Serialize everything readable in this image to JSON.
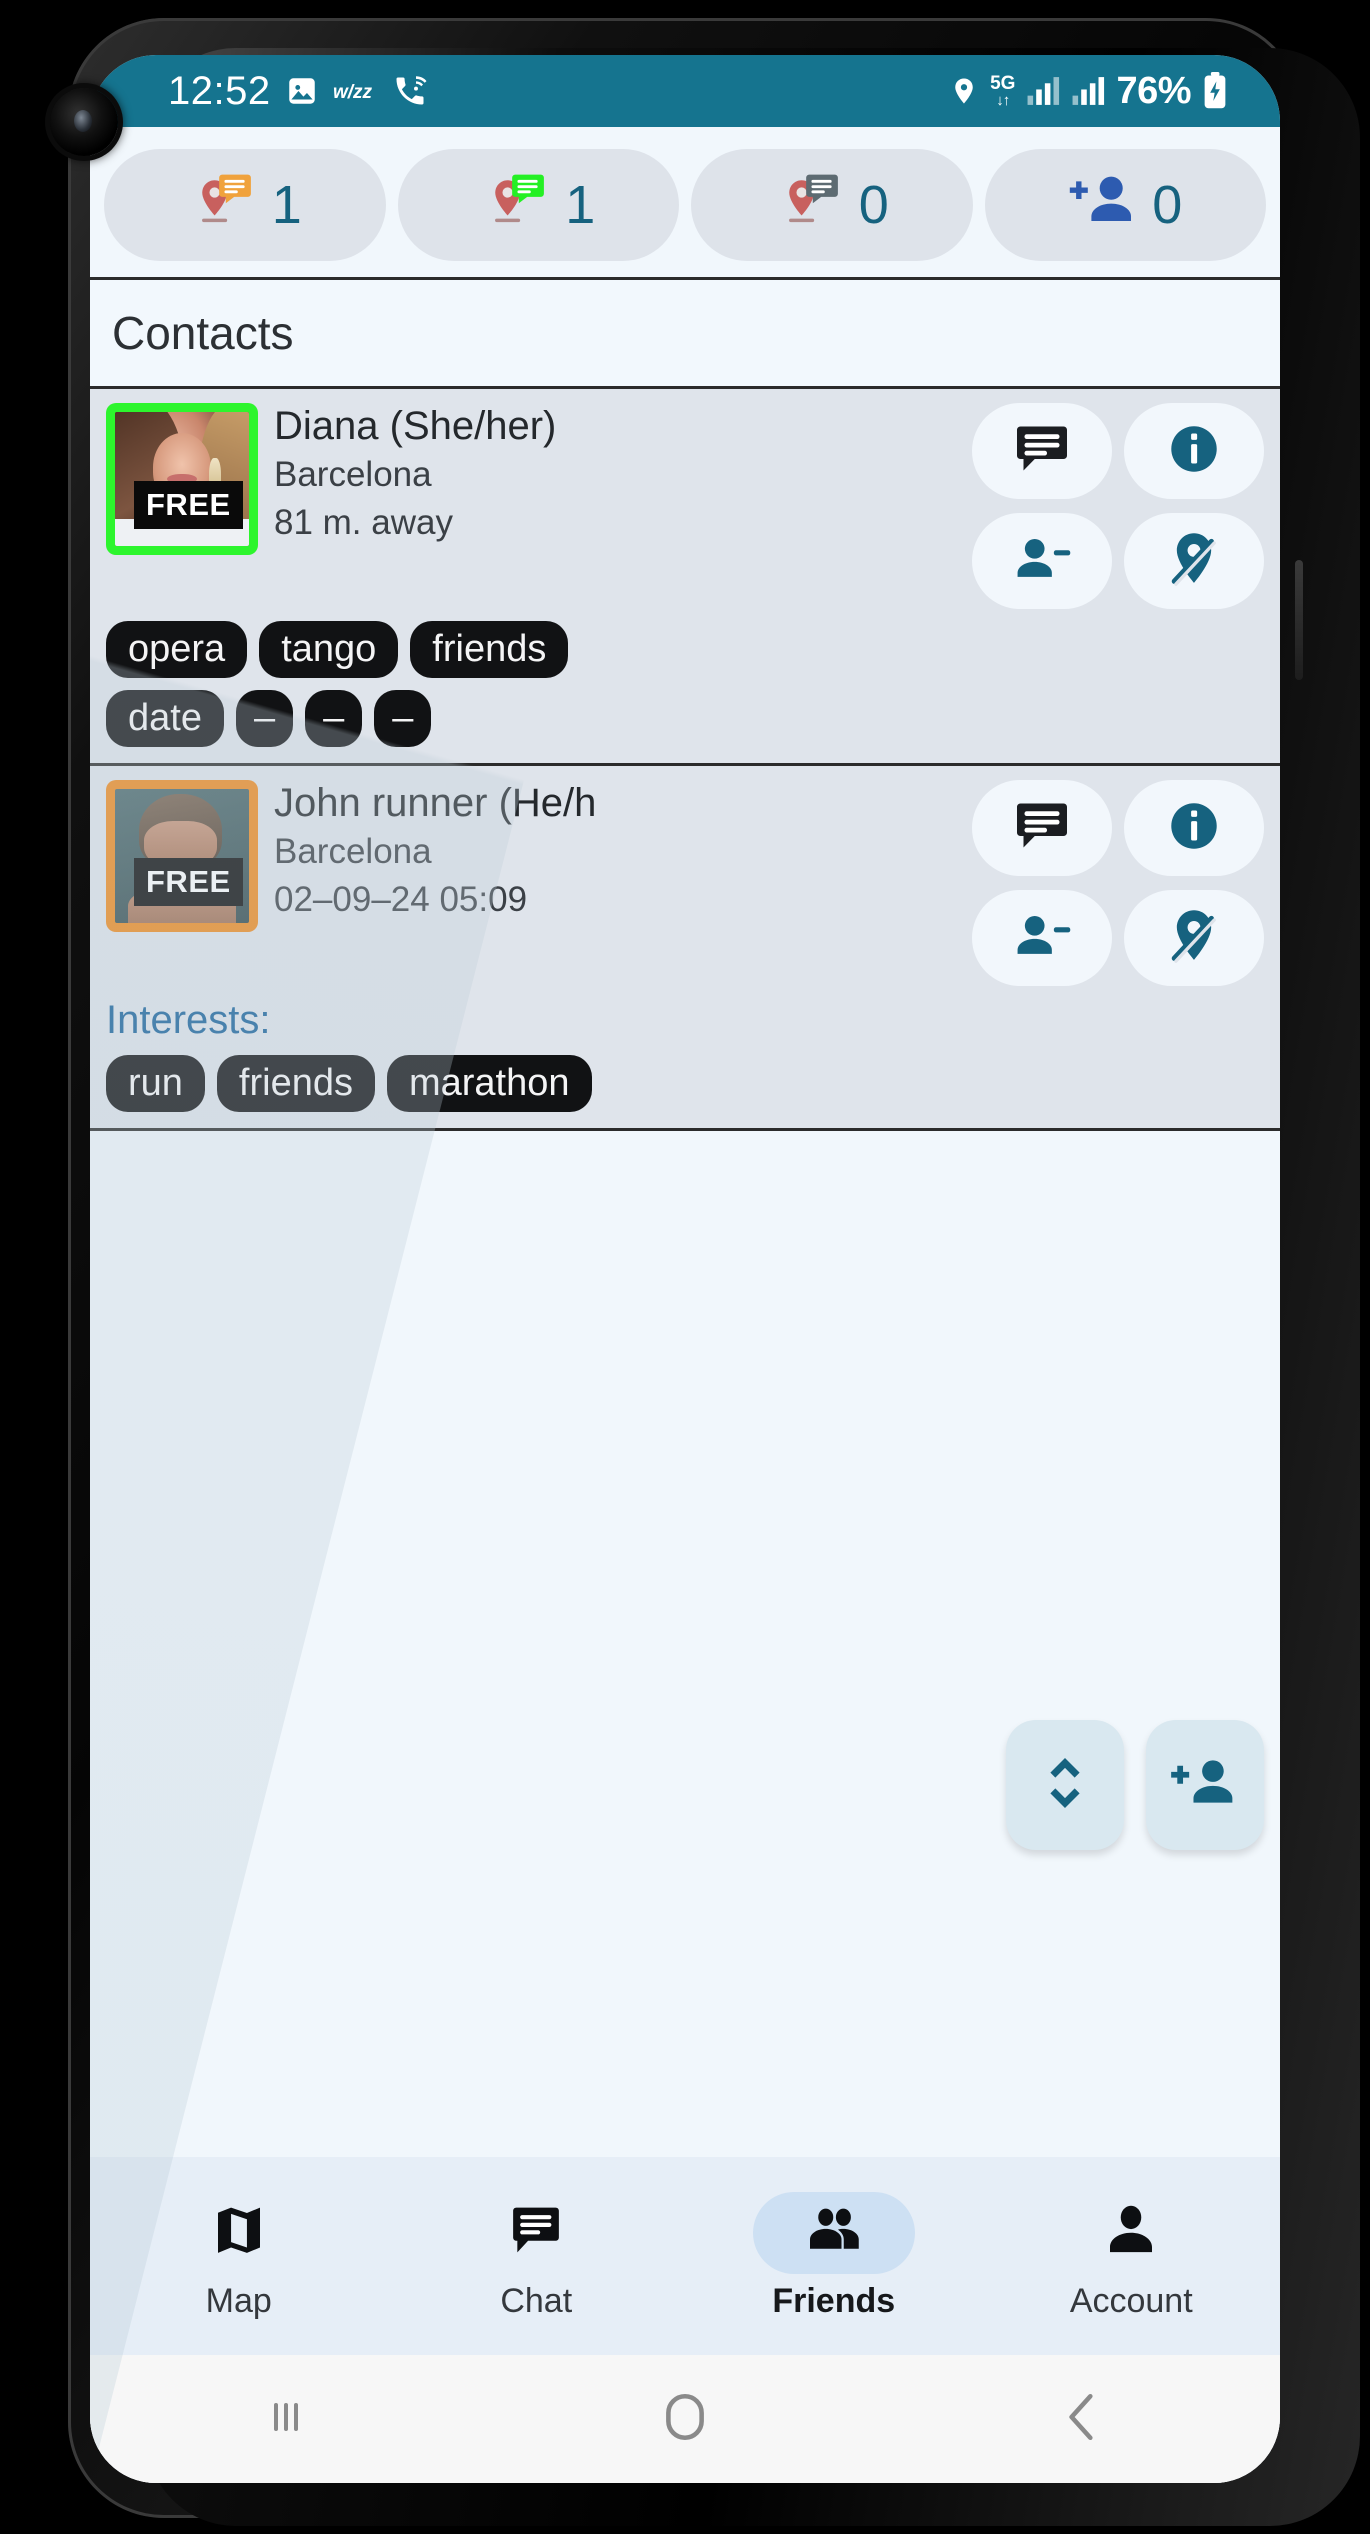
{
  "status_bar": {
    "clock": "12:52",
    "battery": "76%",
    "network": "5G",
    "icons": [
      "image-icon",
      "wizz-icon",
      "call-wifi-icon",
      "location-icon",
      "signal-icon",
      "signal-icon-2",
      "battery-charging-icon"
    ],
    "bg_color": "#15748f"
  },
  "chips": [
    {
      "name": "pin-orange-message-chip",
      "icon": "location-pin-message-icon",
      "bubble_color": "#f0a23c",
      "count": "1"
    },
    {
      "name": "pin-green-message-chip",
      "icon": "location-pin-message-icon",
      "bubble_color": "#24f024",
      "count": "1"
    },
    {
      "name": "pin-gray-message-chip",
      "icon": "location-pin-message-icon",
      "bubble_color": "#5d6b72",
      "count": "0"
    },
    {
      "name": "add-person-chip",
      "icon": "person-add-icon",
      "bubble_color": "#2d5bb0",
      "count": "0"
    }
  ],
  "section": {
    "title": "Contacts"
  },
  "contacts": [
    {
      "name": "Diana (She/her)",
      "city": "Barcelona",
      "meta": "81 m. away",
      "badge": "FREE",
      "border_color": "#2df52d",
      "interests_label": "",
      "tags_row1": [
        "opera",
        "tango",
        "friends"
      ],
      "tags_row2": [
        "date",
        "–",
        "–",
        "–"
      ],
      "actions": [
        "chat-icon",
        "info-icon",
        "person-remove-icon",
        "location-off-icon"
      ]
    },
    {
      "name": "John runner (He/h",
      "city": "Barcelona",
      "meta": "02–09–24 05:09",
      "badge": "FREE",
      "border_color": "#f08a1e",
      "interests_label": "Interests:",
      "tags_row1": [
        "run",
        "friends",
        "marathon"
      ],
      "tags_row2": [],
      "actions": [
        "chat-icon",
        "info-icon",
        "person-remove-icon",
        "location-off-icon"
      ]
    }
  ],
  "fabs": [
    {
      "name": "sort-fab",
      "icon": "unfold-more-icon"
    },
    {
      "name": "add-friend-fab",
      "icon": "person-add-icon"
    }
  ],
  "bottom_nav": {
    "items": [
      {
        "label": "Map",
        "icon": "map-icon",
        "active": false
      },
      {
        "label": "Chat",
        "icon": "chat-icon",
        "active": false
      },
      {
        "label": "Friends",
        "icon": "people-icon",
        "active": true
      },
      {
        "label": "Account",
        "icon": "person-icon",
        "active": false
      }
    ]
  },
  "system_nav": {
    "items": [
      {
        "name": "recents-button",
        "icon": "recents-icon"
      },
      {
        "name": "home-button",
        "icon": "home-icon"
      },
      {
        "name": "back-button",
        "icon": "back-icon"
      }
    ]
  },
  "colors": {
    "accent_teal": "#16627f",
    "status_bar": "#15748f",
    "card_bg": "#dfe4eb",
    "page_bg": "#f1f7fc",
    "nav_bg": "#e6eef7",
    "tag_bg": "#111214",
    "interests_blue": "#19639c"
  }
}
